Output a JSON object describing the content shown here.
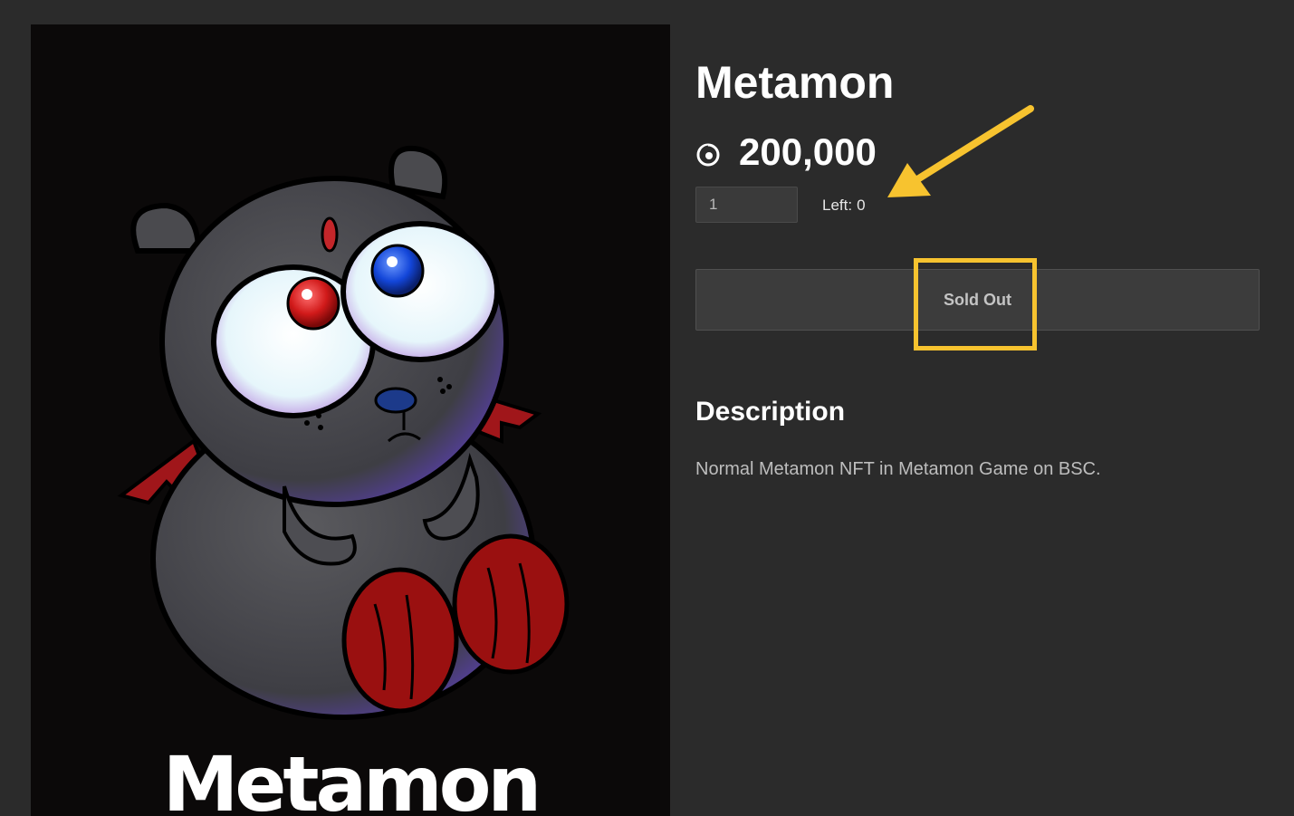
{
  "nft_image": {
    "caption": "Metamon",
    "colors": {
      "background": "#0b0909",
      "body": "#4a4a4d",
      "left_eye": "#d11a1a",
      "right_eye": "#1346d9",
      "feet": "#9a1010"
    }
  },
  "product": {
    "title": "Metamon",
    "price": "200,000",
    "price_icon": "token-icon",
    "quantity_value": "1",
    "left_label": "Left:",
    "left_value": "0",
    "button_label": "Sold Out"
  },
  "description": {
    "heading": "Description",
    "text": "Normal Metamon NFT in Metamon Game on BSC."
  },
  "annotations": {
    "highlight_color": "#f7c32f",
    "arrow_color": "#f7c32f"
  }
}
